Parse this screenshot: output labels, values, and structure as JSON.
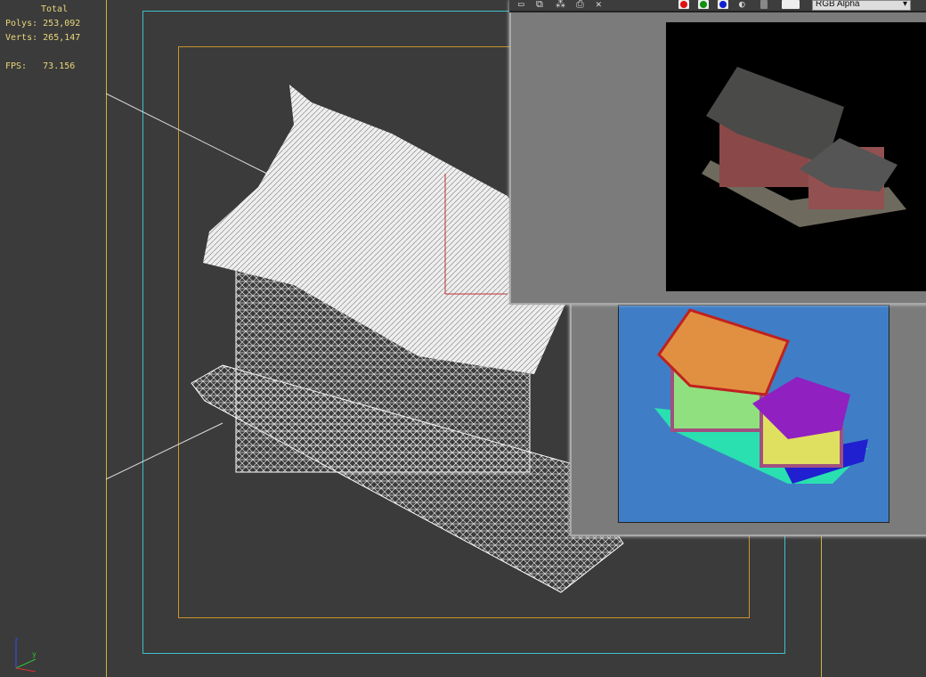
{
  "viewport": {
    "stats_header": "Total",
    "polys_label": "Polys:",
    "polys": "253,092",
    "verts_label": "Verts:",
    "verts": "265,147",
    "fps_label": "FPS:",
    "fps": "73.156",
    "axis_labels": [
      "z",
      "y",
      "x"
    ]
  },
  "render_window": {
    "toolbar_icons": [
      "save-icon",
      "copy-icon",
      "clone-icon",
      "print-icon",
      "close-icon"
    ],
    "channel_colors": {
      "red": "#e01010",
      "green": "#109010",
      "blue": "#1020d0"
    },
    "channel_select": "RGB Alpha"
  },
  "colors": {
    "viewport_bg": "#3b3b3b",
    "safe_frame": "#3fc0c8",
    "render_frame": "#c8952a",
    "id_render_bg": "#3f7ec6"
  }
}
